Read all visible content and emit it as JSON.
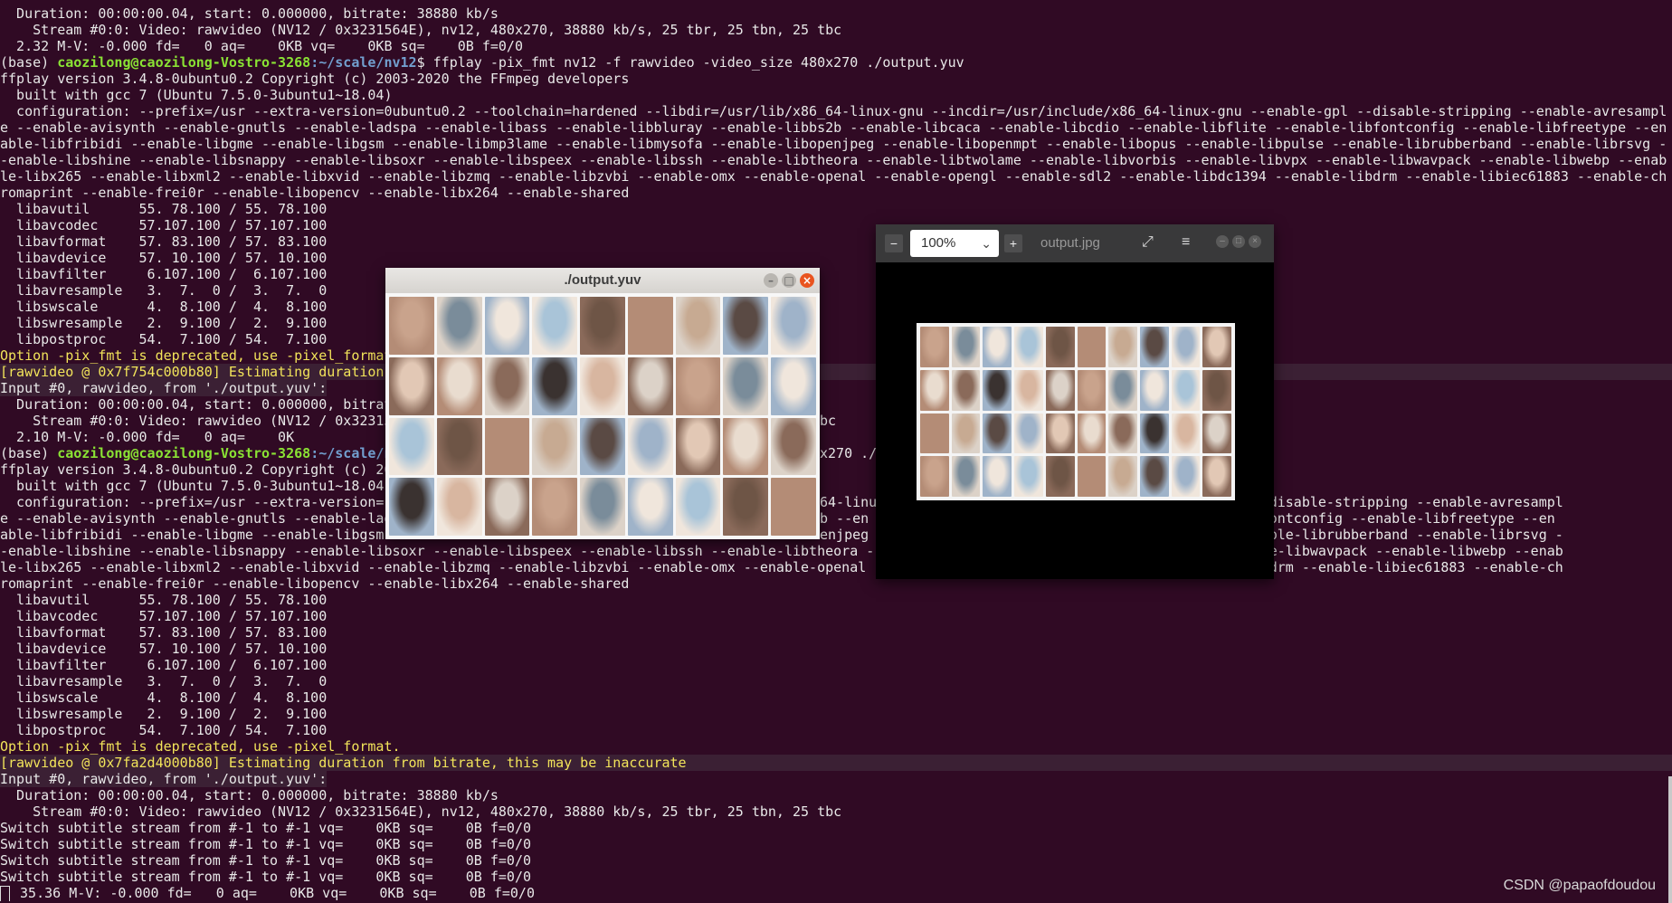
{
  "terminal": {
    "lines": [
      {
        "t": "  Duration: 00:00:00.04, start: 0.000000, bitrate: 38880 kb/s"
      },
      {
        "t": "    Stream #0:0: Video: rawvideo (NV12 / 0x3231564E), nv12, 480x270, 38880 kb/s, 25 tbr, 25 tbn, 25 tbc"
      },
      {
        "t": "  2.32 M-V: -0.000 fd=   0 aq=    0KB vq=    0KB sq=    0B f=0/0"
      },
      {
        "prompt": true,
        "env": "(base) ",
        "user": "caozilong@caozilong-Vostro-3268",
        "path": ":~/scale/nv12",
        "cmd": "$ ffplay -pix_fmt nv12 -f rawvideo -video_size 480x270 ./output.yuv"
      },
      {
        "t": "ffplay version 3.4.8-0ubuntu0.2 Copyright (c) 2003-2020 the FFmpeg developers"
      },
      {
        "t": "  built with gcc 7 (Ubuntu 7.5.0-3ubuntu1~18.04)"
      },
      {
        "t": "  configuration: --prefix=/usr --extra-version=0ubuntu0.2 --toolchain=hardened --libdir=/usr/lib/x86_64-linux-gnu --incdir=/usr/include/x86_64-linux-gnu --enable-gpl --disable-stripping --enable-avresampl"
      },
      {
        "t": "e --enable-avisynth --enable-gnutls --enable-ladspa --enable-libass --enable-libbluray --enable-libbs2b --enable-libcaca --enable-libcdio --enable-libflite --enable-libfontconfig --enable-libfreetype --en"
      },
      {
        "t": "able-libfribidi --enable-libgme --enable-libgsm --enable-libmp3lame --enable-libmysofa --enable-libopenjpeg --enable-libopenmpt --enable-libopus --enable-libpulse --enable-librubberband --enable-librsvg -"
      },
      {
        "t": "-enable-libshine --enable-libsnappy --enable-libsoxr --enable-libspeex --enable-libssh --enable-libtheora --enable-libtwolame --enable-libvorbis --enable-libvpx --enable-libwavpack --enable-libwebp --enab"
      },
      {
        "t": "le-libx265 --enable-libxml2 --enable-libxvid --enable-libzmq --enable-libzvbi --enable-omx --enable-openal --enable-opengl --enable-sdl2 --enable-libdc1394 --enable-libdrm --enable-libiec61883 --enable-ch"
      },
      {
        "t": "romaprint --enable-frei0r --enable-libopencv --enable-libx264 --enable-shared"
      },
      {
        "t": "  libavutil      55. 78.100 / 55. 78.100"
      },
      {
        "t": "  libavcodec     57.107.100 / 57.107.100"
      },
      {
        "t": "  libavformat    57. 83.100 / 57. 83.100"
      },
      {
        "t": "  libavdevice    57. 10.100 / 57. 10.100"
      },
      {
        "t": "  libavfilter     6.107.100 /  6.107.100"
      },
      {
        "t": "  libavresample   3.  7.  0 /  3.  7.  0"
      },
      {
        "t": "  libswscale      4.  8.100 /  4.  8.100"
      },
      {
        "t": "  libswresample   2.  9.100 /  2.  9.100"
      },
      {
        "t": "  libpostproc    54.  7.100 / 54.  7.100"
      },
      {
        "t": "Option -pix_fmt is deprecated, use -pixel_format.",
        "c": "yellow"
      },
      {
        "t": "[rawvideo @ 0x7f754c000b80] Estimating duration",
        "c": "yellow",
        "hl": true
      },
      {
        "t": "Input #0, rawvideo, from './output.yuv':",
        "hl2": true
      },
      {
        "t": "  Duration: 00:00:00.04, start: 0.000000, bitrat"
      },
      {
        "t": "    Stream #0:0: Video: rawvideo (NV12 / 0x32315"
      },
      {
        "t": "  2.10 M-V: -0.000 fd=   0 aq=    0K"
      },
      {
        "prompt": true,
        "env": "(base) ",
        "user": "caozilong@caozilong-Vostro-3268",
        "path": ":~/scale/n",
        "cmd": ""
      },
      {
        "t": "ffplay version 3.4.8-0ubuntu0.2 Copyright (c) 20"
      },
      {
        "t": "  built with gcc 7 (Ubuntu 7.5.0-3ubuntu1~18.04)"
      },
      {
        "t": "  configuration: --prefix=/usr --extra-version="
      },
      {
        "t": "e --enable-avisynth --enable-gnutls --enable-lad"
      },
      {
        "t": "able-libfribidi --enable-libgme --enable-libgsm"
      },
      {
        "t": "-enable-libshine --enable-libsnappy --enable-libsoxr --enable-libspeex --enable-libssh --enable-libtheora --"
      },
      {
        "t": "le-libx265 --enable-libxml2 --enable-libxvid --enable-libzmq --enable-libzvbi --enable-omx --enable-openal --"
      },
      {
        "t": "romaprint --enable-frei0r --enable-libopencv --enable-libx264 --enable-shared"
      },
      {
        "t": "  libavutil      55. 78.100 / 55. 78.100"
      },
      {
        "t": "  libavcodec     57.107.100 / 57.107.100"
      },
      {
        "t": "  libavformat    57. 83.100 / 57. 83.100"
      },
      {
        "t": "  libavdevice    57. 10.100 / 57. 10.100"
      },
      {
        "t": "  libavfilter     6.107.100 /  6.107.100"
      },
      {
        "t": "  libavresample   3.  7.  0 /  3.  7.  0"
      },
      {
        "t": "  libswscale      4.  8.100 /  4.  8.100"
      },
      {
        "t": "  libswresample   2.  9.100 /  2.  9.100"
      },
      {
        "t": "  libpostproc    54.  7.100 / 54.  7.100"
      },
      {
        "t": "Option -pix_fmt is deprecated, use -pixel_format.",
        "c": "yellow"
      },
      {
        "t": "[rawvideo @ 0x7fa2d4000b80] Estimating duration from bitrate, this may be inaccurate",
        "c": "yellow",
        "hl": true
      },
      {
        "t": "Input #0, rawvideo, from './output.yuv':",
        "hl2": true
      },
      {
        "t": "  Duration: 00:00:00.04, start: 0.000000, bitrate: 38880 kb/s"
      },
      {
        "t": "    Stream #0:0: Video: rawvideo (NV12 / 0x3231564E), nv12, 480x270, 38880 kb/s, 25 tbr, 25 tbn, 25 tbc"
      },
      {
        "t": "Switch subtitle stream from #-1 to #-1 vq=    0KB sq=    0B f=0/0"
      },
      {
        "t": "Switch subtitle stream from #-1 to #-1 vq=    0KB sq=    0B f=0/0"
      },
      {
        "t": "Switch subtitle stream from #-1 to #-1 vq=    0KB sq=    0B f=0/0"
      },
      {
        "t": "Switch subtitle stream from #-1 to #-1 vq=    0KB sq=    0B f=0/0"
      },
      {
        "t": " 35.36 M-V: -0.000 fd=   0 aq=    0KB vq=    0KB sq=    0B f=0/0",
        "cursor": true
      }
    ],
    "overlay_right": [
      {
        "row": 25,
        "t": "bc"
      },
      {
        "row": 27,
        "t": "x270 ./"
      },
      {
        "row": 30,
        "t": "64-linu                                     able-gpl --disable-stripping --enable-avresampl"
      },
      {
        "row": 31,
        "t": "b --en                                      enable-libfontconfig --enable-libfreetype --en"
      },
      {
        "row": 32,
        "t": "enjpeg                                      pulse --enable-librubberband --enable-librsvg -"
      },
      {
        "row": 33,
        "t": "                                            vpx --enable-libwavpack --enable-libwebp --enab"
      },
      {
        "row": 34,
        "t": "                                            -enable-libdrm --enable-libiec61883 --enable-ch"
      }
    ],
    "watermark": "CSDN @papaofdoudou"
  },
  "ffplay_window": {
    "title": "./output.yuv",
    "minimize": "–",
    "maximize": "□",
    "close": "×"
  },
  "viewer_window": {
    "zoom_out": "−",
    "zoom_value": "100%",
    "zoom_in": "+",
    "title": "output.jpg",
    "fullscreen": "⤢",
    "menu": "≡",
    "minimize": "–",
    "maximize": "□",
    "close": "×"
  },
  "colors": {
    "terminal_bg": "#300a24",
    "prompt_user": "#8ae234",
    "prompt_path": "#729fcf",
    "warning": "#f2e45a"
  }
}
